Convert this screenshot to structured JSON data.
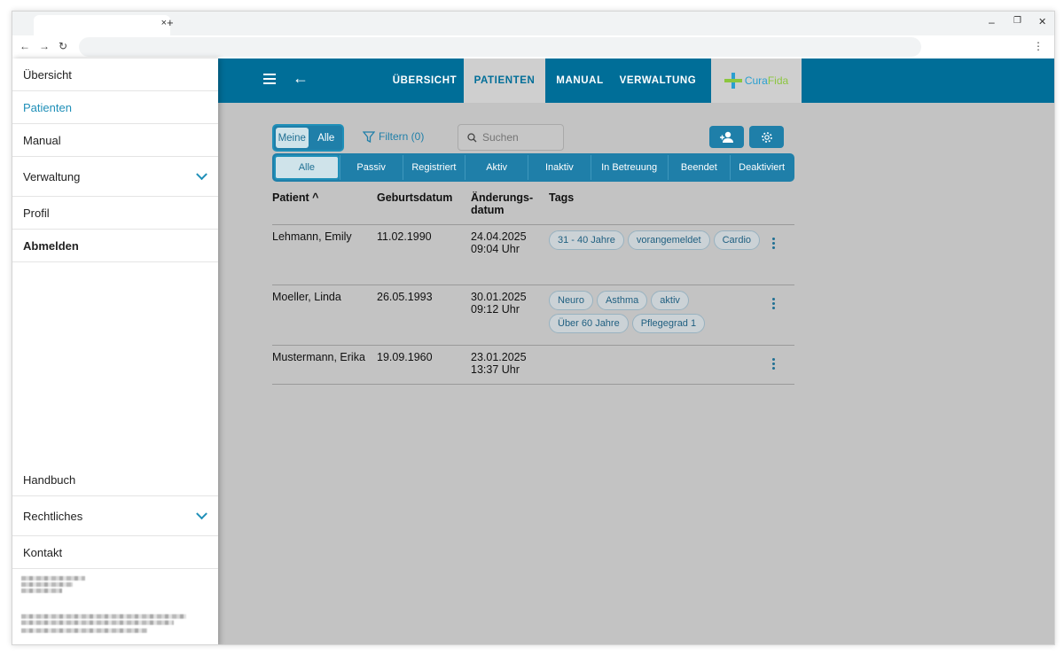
{
  "browser": {
    "new_tab": "+",
    "tab_close": "×",
    "minimize": "–",
    "restore": "❐",
    "close": "✕",
    "back": "←",
    "forward": "→",
    "reload": "↻",
    "menu": "⋮"
  },
  "drawer": {
    "items": [
      {
        "label": "Übersicht"
      },
      {
        "label": "Patienten"
      },
      {
        "label": "Manual"
      },
      {
        "label": "Verwaltung"
      },
      {
        "label": "Profil"
      },
      {
        "label": "Abmelden"
      }
    ],
    "bottom_items": [
      {
        "label": "Handbuch"
      },
      {
        "label": "Rechtliches"
      },
      {
        "label": "Kontakt"
      }
    ]
  },
  "appbar": {
    "back": "←",
    "tabs": [
      {
        "label": "ÜBERSICHT"
      },
      {
        "label": "PATIENTEN"
      },
      {
        "label": "MANUAL"
      },
      {
        "label": "VERWALTUNG"
      }
    ],
    "logo_part1": "Cura",
    "logo_part2": "Fida"
  },
  "toolbar": {
    "toggle": [
      "Meine",
      "Alle"
    ],
    "filter_label": "Filtern (0)",
    "search_placeholder": "Suchen"
  },
  "status_tabs": [
    "Alle",
    "Passiv",
    "Registriert",
    "Aktiv",
    "Inaktiv",
    "In Betreuung",
    "Beendet",
    "Deaktiviert"
  ],
  "table": {
    "headers": {
      "patient": "Patient",
      "sort_indicator": "^",
      "birthdate": "Geburtsdatum",
      "changed": "Änderungs-datum",
      "tags": "Tags"
    },
    "rows": [
      {
        "name": "Lehmann, Emily",
        "birthdate": "11.02.1990",
        "date": "24.04.2025",
        "time": "09:04 Uhr",
        "tags": [
          "31 - 40 Jahre",
          "vorangemeldet",
          "Cardio"
        ]
      },
      {
        "name": "Moeller, Linda",
        "birthdate": "26.05.1993",
        "date": "30.01.2025",
        "time": "09:12 Uhr",
        "tags": [
          "Neuro",
          "Asthma",
          "aktiv",
          "Über 60 Jahre",
          "Pflegegrad 1"
        ]
      },
      {
        "name": "Mustermann, Erika",
        "birthdate": "19.09.1960",
        "date": "23.01.2025",
        "time": "13:37 Uhr",
        "tags": []
      }
    ]
  },
  "colors": {
    "primary": "#006e98",
    "accent": "#1f8fb8",
    "overlay": "#c3c3c3"
  }
}
